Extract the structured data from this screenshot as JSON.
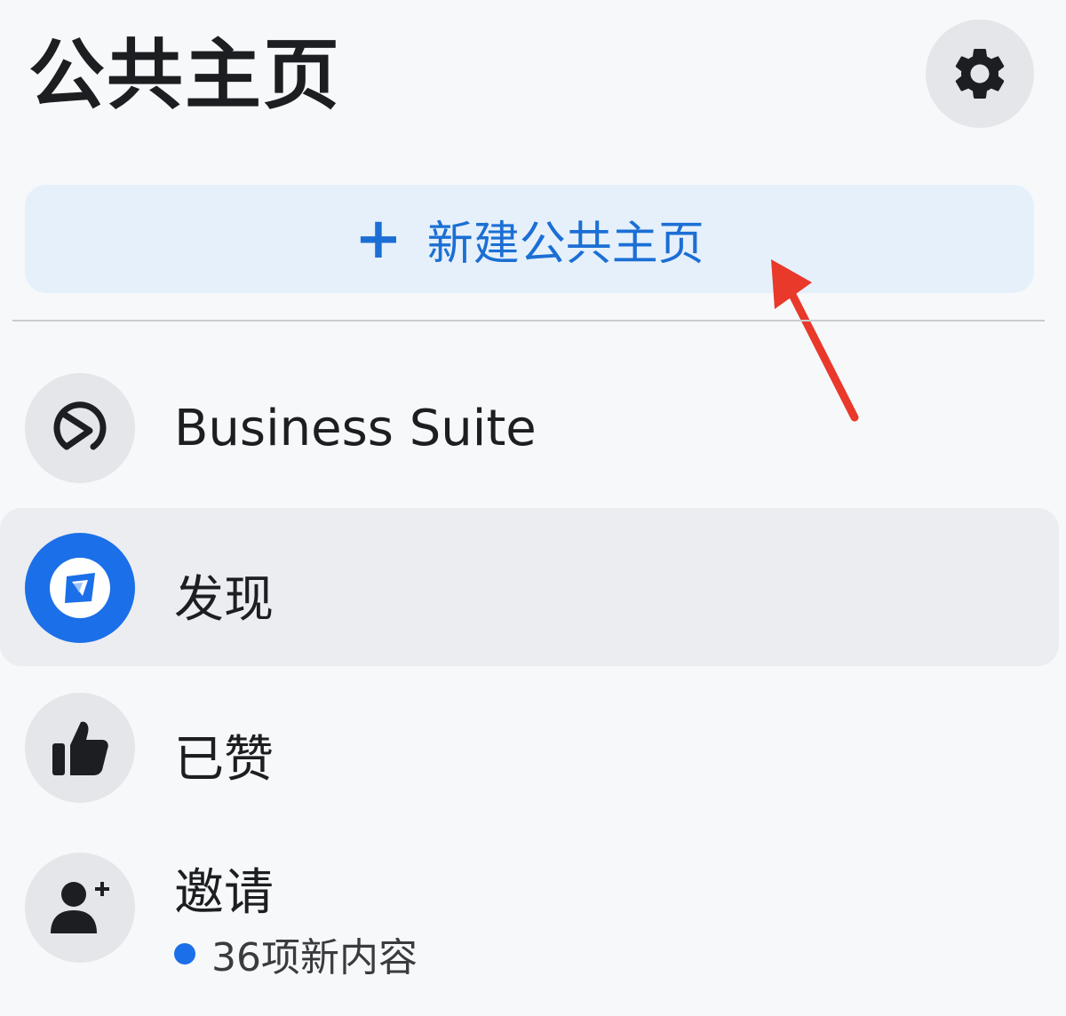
{
  "header": {
    "title": "公共主页"
  },
  "actions": {
    "new_page_plus": "+",
    "new_page_label": "新建公共主页"
  },
  "menu": {
    "items": [
      {
        "label": "Business Suite",
        "icon": "business-suite-icon"
      },
      {
        "label": "发现",
        "icon": "discover-icon",
        "selected": true
      },
      {
        "label": "已赞",
        "icon": "thumbs-up-icon"
      },
      {
        "label": "邀请",
        "icon": "add-person-icon",
        "sub": "36项新内容"
      }
    ]
  },
  "colors": {
    "accent": "#1b6fe8",
    "button_bg": "#e6f0fb",
    "annotation": "#e8392b"
  }
}
